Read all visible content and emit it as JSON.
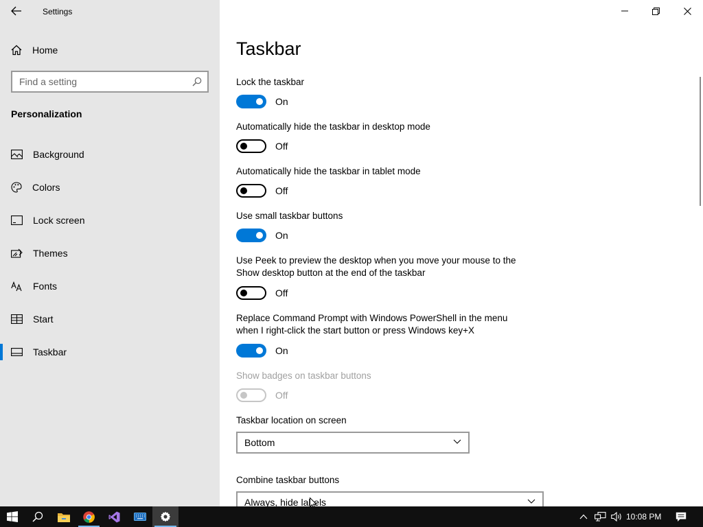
{
  "window": {
    "title": "Settings",
    "back_icon": "back-arrow-icon",
    "controls": [
      "minimize-icon",
      "restore-icon",
      "close-icon"
    ]
  },
  "sidebar": {
    "home": {
      "label": "Home",
      "icon": "home-icon"
    },
    "search": {
      "placeholder": "Find a setting",
      "value": "",
      "icon": "search-icon"
    },
    "section": "Personalization",
    "items": [
      {
        "label": "Background",
        "icon": "image-icon",
        "active": false
      },
      {
        "label": "Colors",
        "icon": "palette-icon",
        "active": false
      },
      {
        "label": "Lock screen",
        "icon": "lock-screen-icon",
        "active": false
      },
      {
        "label": "Themes",
        "icon": "themes-icon",
        "active": false
      },
      {
        "label": "Fonts",
        "icon": "fonts-icon",
        "active": false
      },
      {
        "label": "Start",
        "icon": "start-icon",
        "active": false
      },
      {
        "label": "Taskbar",
        "icon": "taskbar-icon",
        "active": true
      }
    ]
  },
  "main": {
    "title": "Taskbar",
    "settings": [
      {
        "label": "Lock the taskbar",
        "state": "On",
        "on": true,
        "enabled": true
      },
      {
        "label": "Automatically hide the taskbar in desktop mode",
        "state": "Off",
        "on": false,
        "enabled": true
      },
      {
        "label": "Automatically hide the taskbar in tablet mode",
        "state": "Off",
        "on": false,
        "enabled": true
      },
      {
        "label": "Use small taskbar buttons",
        "state": "On",
        "on": true,
        "enabled": true
      },
      {
        "label_line1": "Use Peek to preview the desktop when you move your mouse to the",
        "label_line2": "Show desktop button at the end of the taskbar",
        "state": "Off",
        "on": false,
        "enabled": true
      },
      {
        "label_line1": "Replace Command Prompt with Windows PowerShell in the menu",
        "label_line2": "when I right-click the start button or press Windows key+X",
        "state": "On",
        "on": true,
        "enabled": true
      },
      {
        "label": "Show badges on taskbar buttons",
        "state": "Off",
        "on": false,
        "enabled": false
      }
    ],
    "location": {
      "label": "Taskbar location on screen",
      "value": "Bottom"
    },
    "combine": {
      "label": "Combine taskbar buttons",
      "value": "Always, hide labels"
    }
  },
  "taskbar": {
    "apps": [
      "windows-start-icon",
      "search-icon",
      "file-explorer-icon",
      "chrome-icon",
      "visual-studio-icon",
      "keyboard-icon",
      "settings-gear-icon"
    ],
    "tray": [
      "chevron-up-icon",
      "network-icon",
      "volume-icon"
    ],
    "clock": "10:08 PM",
    "notification_icon": "notification-icon"
  },
  "colors": {
    "accent": "#0078d7",
    "sidebar_bg": "#e6e6e6",
    "taskbar_bg": "#101010",
    "disabled_text": "#a0a0a0"
  }
}
